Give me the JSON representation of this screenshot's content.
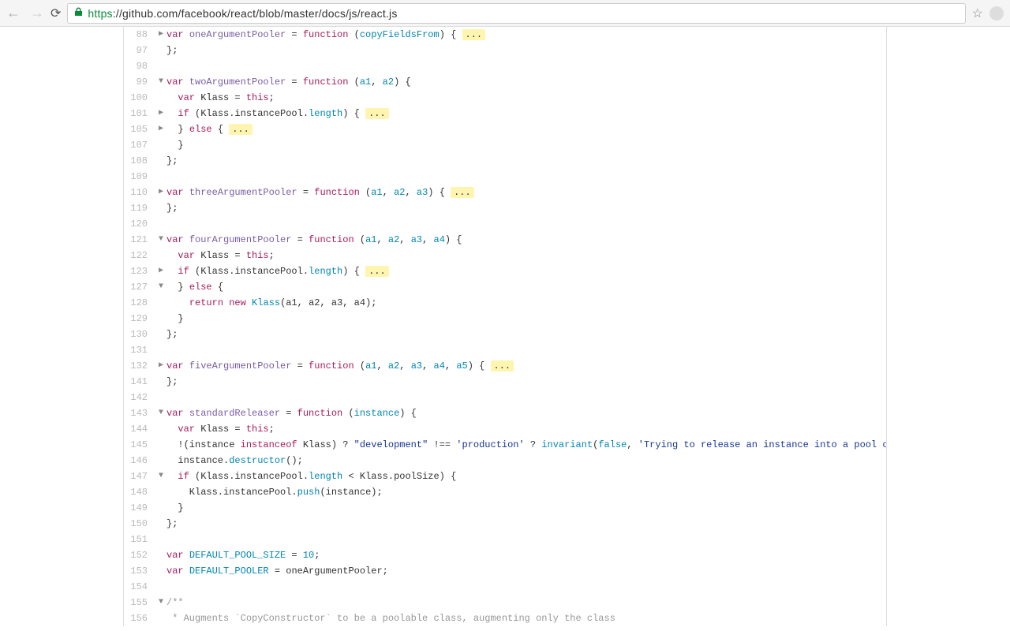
{
  "browser": {
    "url_proto": "https",
    "url_rest": "://github.com/facebook/react/blob/master/docs/js/react.js"
  },
  "lines": [
    {
      "n": "88",
      "a": "▶",
      "html": "<span class='k'>var</span> <span class='id'>oneArgumentPooler</span> = <span class='k'>function</span> (<span class='fn'>copyFieldsFrom</span>) { <span class='fold'>...</span>"
    },
    {
      "n": "97",
      "a": "",
      "html": "};"
    },
    {
      "n": "98",
      "a": "",
      "html": ""
    },
    {
      "n": "99",
      "a": "▼",
      "html": "<span class='k'>var</span> <span class='id'>twoArgumentPooler</span> = <span class='k'>function</span> (<span class='fn'>a1</span>, <span class='fn'>a2</span>) {"
    },
    {
      "n": "100",
      "a": "",
      "html": "  <span class='k'>var</span> Klass = <span class='k'>this</span>;"
    },
    {
      "n": "101",
      "a": "▶",
      "html": "  <span class='k'>if</span> (Klass.instancePool.<span class='fn'>length</span>) { <span class='fold'>...</span>"
    },
    {
      "n": "105",
      "a": "▶",
      "html": "  } <span class='k'>else</span> { <span class='fold'>...</span>"
    },
    {
      "n": "107",
      "a": "",
      "html": "  }"
    },
    {
      "n": "108",
      "a": "",
      "html": "};"
    },
    {
      "n": "109",
      "a": "",
      "html": ""
    },
    {
      "n": "110",
      "a": "▶",
      "html": "<span class='k'>var</span> <span class='id'>threeArgumentPooler</span> = <span class='k'>function</span> (<span class='fn'>a1</span>, <span class='fn'>a2</span>, <span class='fn'>a3</span>) { <span class='fold'>...</span>"
    },
    {
      "n": "119",
      "a": "",
      "html": "};"
    },
    {
      "n": "120",
      "a": "",
      "html": ""
    },
    {
      "n": "121",
      "a": "▼",
      "html": "<span class='k'>var</span> <span class='id'>fourArgumentPooler</span> = <span class='k'>function</span> (<span class='fn'>a1</span>, <span class='fn'>a2</span>, <span class='fn'>a3</span>, <span class='fn'>a4</span>) {"
    },
    {
      "n": "122",
      "a": "",
      "html": "  <span class='k'>var</span> Klass = <span class='k'>this</span>;"
    },
    {
      "n": "123",
      "a": "▶",
      "html": "  <span class='k'>if</span> (Klass.instancePool.<span class='fn'>length</span>) { <span class='fold'>...</span>"
    },
    {
      "n": "127",
      "a": "▼",
      "html": "  } <span class='k'>else</span> {"
    },
    {
      "n": "128",
      "a": "",
      "html": "    <span class='k'>return</span> <span class='k'>new</span> <span class='fn'>Klass</span>(a1, a2, a3, a4);"
    },
    {
      "n": "129",
      "a": "",
      "html": "  }"
    },
    {
      "n": "130",
      "a": "",
      "html": "};"
    },
    {
      "n": "131",
      "a": "",
      "html": ""
    },
    {
      "n": "132",
      "a": "▶",
      "html": "<span class='k'>var</span> <span class='id'>fiveArgumentPooler</span> = <span class='k'>function</span> (<span class='fn'>a1</span>, <span class='fn'>a2</span>, <span class='fn'>a3</span>, <span class='fn'>a4</span>, <span class='fn'>a5</span>) { <span class='fold'>...</span>"
    },
    {
      "n": "141",
      "a": "",
      "html": "};"
    },
    {
      "n": "142",
      "a": "",
      "html": ""
    },
    {
      "n": "143",
      "a": "▼",
      "html": "<span class='k'>var</span> <span class='id'>standardReleaser</span> = <span class='k'>function</span> (<span class='fn'>instance</span>) {"
    },
    {
      "n": "144",
      "a": "",
      "html": "  <span class='k'>var</span> Klass = <span class='k'>this</span>;"
    },
    {
      "n": "145",
      "a": "",
      "html": "  !(instance <span class='k'>instanceof</span> Klass) ? <span class='s'>\"development\"</span> !== <span class='s'>'production'</span> ? <span class='fn'>invariant</span>(<span class='n'>false</span>, <span class='s'>'Trying to release an instance into a pool of a differer</span>"
    },
    {
      "n": "146",
      "a": "",
      "html": "  instance.<span class='fn'>destructor</span>();"
    },
    {
      "n": "147",
      "a": "▼",
      "html": "  <span class='k'>if</span> (Klass.instancePool.<span class='fn'>length</span> &lt; Klass.poolSize) {"
    },
    {
      "n": "148",
      "a": "",
      "html": "    Klass.instancePool.<span class='fn'>push</span>(instance);"
    },
    {
      "n": "149",
      "a": "",
      "html": "  }"
    },
    {
      "n": "150",
      "a": "",
      "html": "};"
    },
    {
      "n": "151",
      "a": "",
      "html": ""
    },
    {
      "n": "152",
      "a": "",
      "html": "<span class='k'>var</span> <span class='fn'>DEFAULT_POOL_SIZE</span> = <span class='n'>10</span>;"
    },
    {
      "n": "153",
      "a": "",
      "html": "<span class='k'>var</span> <span class='fn'>DEFAULT_POOLER</span> = oneArgumentPooler;"
    },
    {
      "n": "154",
      "a": "",
      "html": ""
    },
    {
      "n": "155",
      "a": "▼",
      "html": "<span class='cm'>/**</span>"
    },
    {
      "n": "156",
      "a": "",
      "html": "<span class='cm'> * Augments `CopyConstructor` to be a poolable class, augmenting only the class</span>"
    }
  ]
}
